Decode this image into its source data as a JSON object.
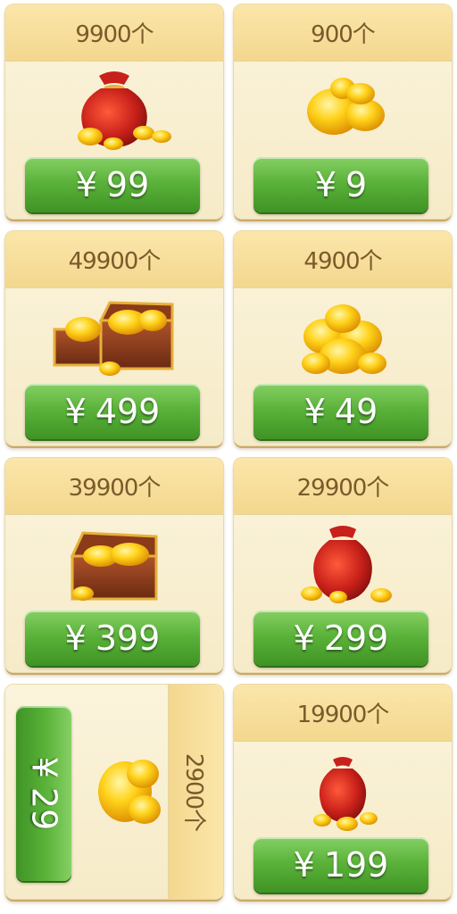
{
  "packages": [
    {
      "amount": "9900个",
      "yen": "¥",
      "price": "99",
      "icon": "red-money-bag-gold-ingots-icon"
    },
    {
      "amount": "900个",
      "yen": "¥",
      "price": "9",
      "icon": "gold-ingot-pile-small-icon"
    },
    {
      "amount": "49900个",
      "yen": "¥",
      "price": "499",
      "icon": "treasure-chests-icon"
    },
    {
      "amount": "4900个",
      "yen": "¥",
      "price": "49",
      "icon": "gold-ingot-pile-icon"
    },
    {
      "amount": "39900个",
      "yen": "¥",
      "price": "399",
      "icon": "treasure-chest-icon"
    },
    {
      "amount": "29900个",
      "yen": "¥",
      "price": "299",
      "icon": "red-money-bag-icon"
    },
    {
      "amount": "2900个",
      "yen": "¥",
      "price": "29",
      "icon": "gold-ingot-stack-icon"
    },
    {
      "amount": "19900个",
      "yen": "¥",
      "price": "199",
      "icon": "small-money-bag-icon"
    }
  ],
  "colors": {
    "header": "#f3d78e",
    "card": "#f6ebc8",
    "button": "#5bb33a",
    "amount_text": "#7a5a2a",
    "gold": "#f5b800",
    "bag": "#c8201a",
    "chest": "#8b3a1a"
  }
}
